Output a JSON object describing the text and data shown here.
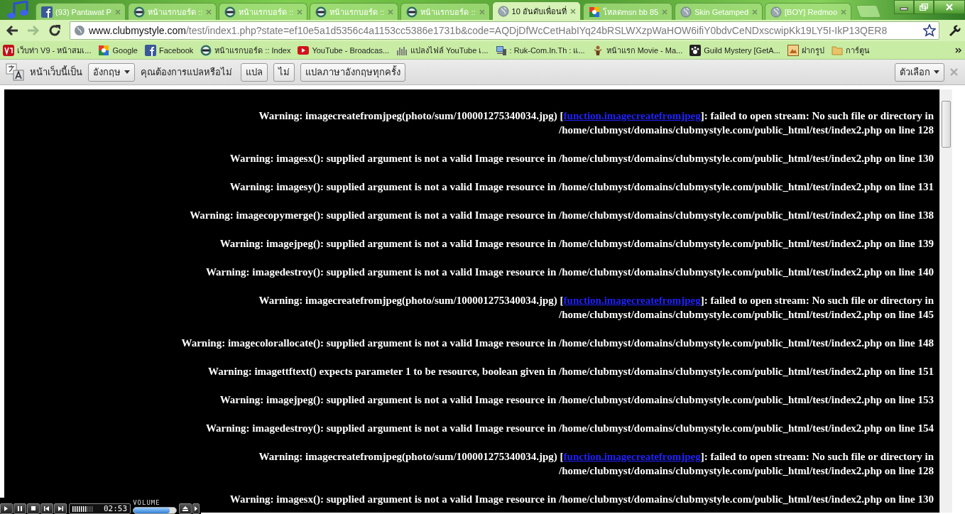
{
  "tabs": [
    {
      "title": "(93) Pantawat P",
      "kind": "facebook",
      "selected": false
    },
    {
      "title": "หน้าแรกบอร์ด ::",
      "kind": "board",
      "selected": false
    },
    {
      "title": "หน้าแรกบอร์ด ::",
      "kind": "board",
      "selected": false
    },
    {
      "title": "หน้าแรกบอร์ด ::",
      "kind": "board",
      "selected": false
    },
    {
      "title": "หน้าแรกบอร์ด ::",
      "kind": "board",
      "selected": false
    },
    {
      "title": "10 อันดับเพื่อนที่",
      "kind": "globe",
      "selected": true
    },
    {
      "title": "โหลดmsn bb 85",
      "kind": "google",
      "selected": false
    },
    {
      "title": "Skin Getamped",
      "kind": "globe",
      "selected": false
    },
    {
      "title": "[BOY] Redmoo",
      "kind": "globe",
      "selected": false
    }
  ],
  "address": {
    "host": "www.clubmystyle.com",
    "path": "/test/index1.php?state=ef10e5a1d5356c4a1153cc5386e1731b&code=AQDjDfWcCetHabIYq24bRSLWXzpWaHOW6ifiY0bdvCeNDxscwipKk19LY5I-IkP13QER8"
  },
  "bookmarks": [
    {
      "title": "เว็บท่า V9 - หน้าสมเ...",
      "kind": "v9"
    },
    {
      "title": "Google",
      "kind": "google"
    },
    {
      "title": "Facebook",
      "kind": "facebook"
    },
    {
      "title": "หน้าแรกบอร์ด :: Index",
      "kind": "board"
    },
    {
      "title": "YouTube - Broadcas...",
      "kind": "youtube"
    },
    {
      "title": "แปลงไฟล์ YouTube เ...",
      "kind": "bars"
    },
    {
      "title": ": Ruk-Com.In.Th : แ...",
      "kind": "computer"
    },
    {
      "title": "หน้าแรก Movie - Ma...",
      "kind": "figure"
    },
    {
      "title": "Guild Mystery [GetA...",
      "kind": "paw"
    },
    {
      "title": "ฝากรูป",
      "kind": "frame"
    },
    {
      "title": "การ์ตูน",
      "kind": "folder"
    }
  ],
  "translate_bar": {
    "intro": "หน้าเว็บนี้เป็น",
    "language": "อังกฤษ",
    "question": "คุณต้องการแปลหรือไม่",
    "buttons": [
      "แปล",
      "ไม่",
      "แปลภาษาอังกฤษทุกครั้ง"
    ],
    "options": "ตัวเลือก"
  },
  "warnings": [
    {
      "text": "Warning: imagecreatefromjpeg(photo/sum/100001275340034.jpg) [",
      "link": "function.imagecreatefromjpeg",
      "after": "]: failed to open stream: No such file or directory in /home/clubmyst/domains/clubmystyle.com/public_html/test/index2.php on line 128"
    },
    {
      "text": "Warning: imagesx(): supplied argument is not a valid Image resource in /home/clubmyst/domains/clubmystyle.com/public_html/test/index2.php on line 130"
    },
    {
      "text": "Warning: imagesy(): supplied argument is not a valid Image resource in /home/clubmyst/domains/clubmystyle.com/public_html/test/index2.php on line 131"
    },
    {
      "text": "Warning: imagecopymerge(): supplied argument is not a valid Image resource in /home/clubmyst/domains/clubmystyle.com/public_html/test/index2.php on line 138"
    },
    {
      "text": "Warning: imagejpeg(): supplied argument is not a valid Image resource in /home/clubmyst/domains/clubmystyle.com/public_html/test/index2.php on line 139"
    },
    {
      "text": "Warning: imagedestroy(): supplied argument is not a valid Image resource in /home/clubmyst/domains/clubmystyle.com/public_html/test/index2.php on line 140"
    },
    {
      "text": "Warning: imagecreatefromjpeg(photo/sum/100001275340034.jpg) [",
      "link": "function.imagecreatefromjpeg",
      "after": "]: failed to open stream: No such file or directory in /home/clubmyst/domains/clubmystyle.com/public_html/test/index2.php on line 145"
    },
    {
      "text": "Warning: imagecolorallocate(): supplied argument is not a valid Image resource in /home/clubmyst/domains/clubmystyle.com/public_html/test/index2.php on line 148"
    },
    {
      "text": "Warning: imagettftext() expects parameter 1 to be resource, boolean given in /home/clubmyst/domains/clubmystyle.com/public_html/test/index2.php on line 151"
    },
    {
      "text": "Warning: imagejpeg(): supplied argument is not a valid Image resource in /home/clubmyst/domains/clubmystyle.com/public_html/test/index2.php on line 153"
    },
    {
      "text": "Warning: imagedestroy(): supplied argument is not a valid Image resource in /home/clubmyst/domains/clubmystyle.com/public_html/test/index2.php on line 154"
    },
    {
      "text": "Warning: imagecreatefromjpeg(photo/sum/100001275340034.jpg) [",
      "link": "function.imagecreatefromjpeg",
      "after": "]: failed to open stream: No such file or directory in /home/clubmyst/domains/clubmystyle.com/public_html/test/index2.php on line 128"
    },
    {
      "text": "Warning: imagesx(): supplied argument is not a valid Image resource in /home/clubmyst/domains/clubmystyle.com/public_html/test/index2.php on line 130"
    }
  ],
  "player": {
    "time": "02:53",
    "volume_label": "VOLUME",
    "volume": {
      "level": 0.85
    }
  }
}
